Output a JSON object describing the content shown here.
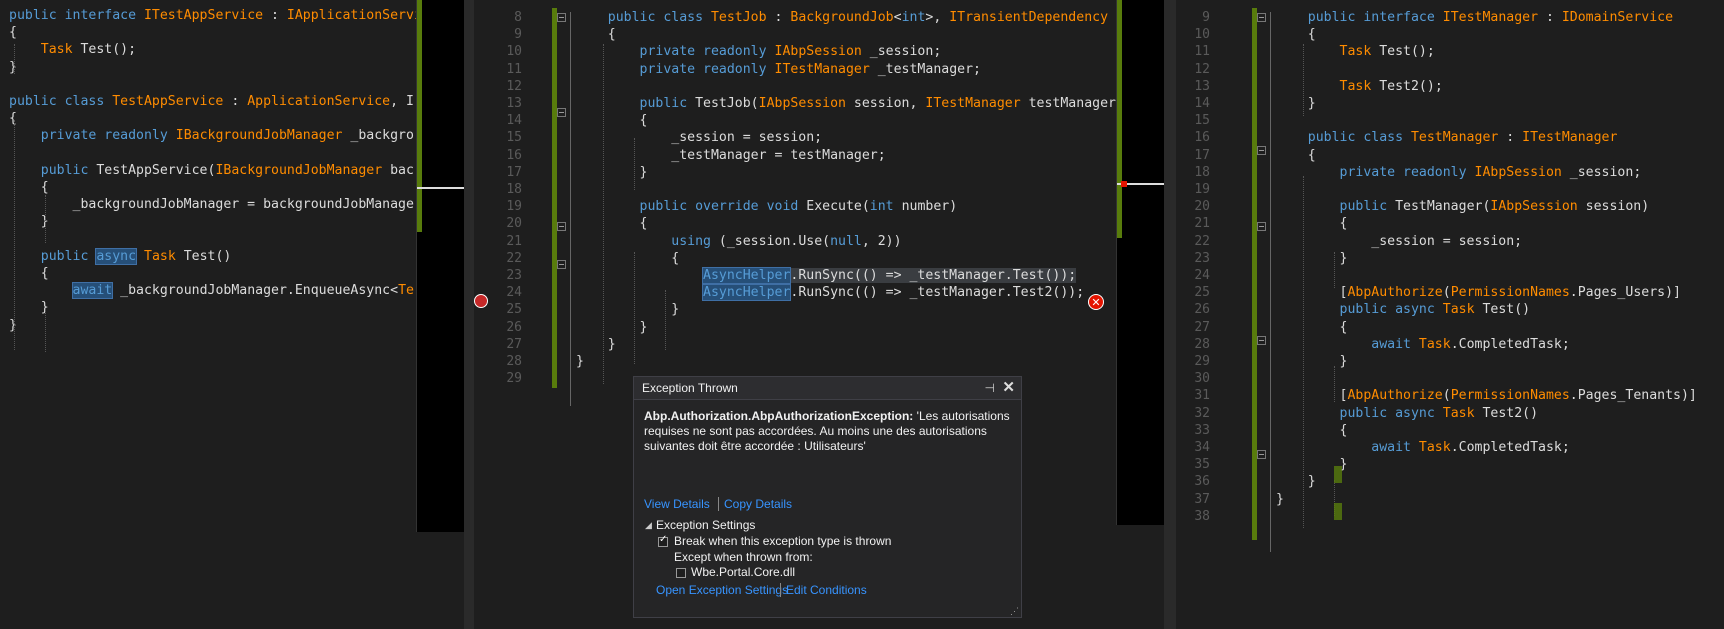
{
  "left": {
    "lines": [
      [
        [
          "kw",
          "public interface "
        ],
        [
          "ty",
          "ITestAppService"
        ],
        [
          "tx",
          " : "
        ],
        [
          "ty",
          "IApplicationServi"
        ]
      ],
      [
        [
          "tx",
          "{"
        ]
      ],
      [
        [
          "tx",
          "    "
        ],
        [
          "ty",
          "Task"
        ],
        [
          "tx",
          " Test();"
        ]
      ],
      [
        [
          "tx",
          "}"
        ]
      ],
      [
        [
          "tx",
          ""
        ]
      ],
      [
        [
          "kw",
          "public class "
        ],
        [
          "ty",
          "TestAppService"
        ],
        [
          "tx",
          " : "
        ],
        [
          "ty",
          "ApplicationService"
        ],
        [
          "tx",
          ", I"
        ]
      ],
      [
        [
          "tx",
          "{"
        ]
      ],
      [
        [
          "tx",
          "    "
        ],
        [
          "kw",
          "private readonly "
        ],
        [
          "ty",
          "IBackgroundJobManager"
        ],
        [
          "tx",
          " _backgro"
        ]
      ],
      [
        [
          "tx",
          ""
        ]
      ],
      [
        [
          "tx",
          "    "
        ],
        [
          "kw",
          "public "
        ],
        [
          "tx",
          "TestAppService("
        ],
        [
          "ty",
          "IBackgroundJobManager"
        ],
        [
          "tx",
          " bac"
        ]
      ],
      [
        [
          "tx",
          "    {"
        ]
      ],
      [
        [
          "tx",
          "        _backgroundJobManager = backgroundJobManage"
        ]
      ],
      [
        [
          "tx",
          "    }"
        ]
      ],
      [
        [
          "tx",
          ""
        ]
      ],
      [
        [
          "tx",
          "    "
        ],
        [
          "kw",
          "public "
        ],
        [
          "hlkw",
          "async"
        ],
        [
          "tx",
          " "
        ],
        [
          "ty",
          "Task"
        ],
        [
          "tx",
          " Test()"
        ]
      ],
      [
        [
          "tx",
          "    {"
        ]
      ],
      [
        [
          "tx",
          "        "
        ],
        [
          "hlkw",
          "await"
        ],
        [
          "tx",
          " _backgroundJobManager.EnqueueAsync<"
        ],
        [
          "ty",
          "Te"
        ]
      ],
      [
        [
          "tx",
          "    }"
        ]
      ],
      [
        [
          "tx",
          "}"
        ]
      ]
    ]
  },
  "middle": {
    "line_numbers": [
      "8",
      "9",
      "10",
      "11",
      "12",
      "13",
      "14",
      "15",
      "16",
      "17",
      "18",
      "19",
      "20",
      "21",
      "22",
      "23",
      "24",
      "25",
      "26",
      "27",
      "28",
      "29"
    ],
    "lines": [
      [
        [
          "tx",
          "    "
        ],
        [
          "kw",
          "public class "
        ],
        [
          "ty",
          "TestJob"
        ],
        [
          "tx",
          " : "
        ],
        [
          "ty",
          "BackgroundJob"
        ],
        [
          "tx",
          "<"
        ],
        [
          "kw",
          "int"
        ],
        [
          "tx",
          ">, "
        ],
        [
          "ty",
          "ITransientDependency"
        ]
      ],
      [
        [
          "tx",
          "    {"
        ]
      ],
      [
        [
          "tx",
          "        "
        ],
        [
          "kw",
          "private readonly "
        ],
        [
          "ty",
          "IAbpSession"
        ],
        [
          "tx",
          " _session;"
        ]
      ],
      [
        [
          "tx",
          "        "
        ],
        [
          "kw",
          "private readonly "
        ],
        [
          "ty",
          "ITestManager"
        ],
        [
          "tx",
          " _testManager;"
        ]
      ],
      [
        [
          "tx",
          ""
        ]
      ],
      [
        [
          "tx",
          "        "
        ],
        [
          "kw",
          "public "
        ],
        [
          "tx",
          "TestJob("
        ],
        [
          "ty",
          "IAbpSession"
        ],
        [
          "tx",
          " session, "
        ],
        [
          "ty",
          "ITestManager"
        ],
        [
          "tx",
          " testManager)"
        ]
      ],
      [
        [
          "tx",
          "        {"
        ]
      ],
      [
        [
          "tx",
          "            _session = session;"
        ]
      ],
      [
        [
          "tx",
          "            _testManager = testManager;"
        ]
      ],
      [
        [
          "tx",
          "        }"
        ]
      ],
      [
        [
          "tx",
          ""
        ]
      ],
      [
        [
          "tx",
          "        "
        ],
        [
          "kw",
          "public override void "
        ],
        [
          "tx",
          "Execute("
        ],
        [
          "kw",
          "int"
        ],
        [
          "tx",
          " number)"
        ]
      ],
      [
        [
          "tx",
          "        {"
        ]
      ],
      [
        [
          "tx",
          "            "
        ],
        [
          "kw",
          "using "
        ],
        [
          "tx",
          "(_session.Use("
        ],
        [
          "kw",
          "null"
        ],
        [
          "tx",
          ", 2))"
        ]
      ],
      [
        [
          "tx",
          "            {"
        ]
      ],
      [
        [
          "tx",
          "                "
        ],
        [
          "hlty",
          "AsyncHelper"
        ],
        [
          "hlsel",
          ".RunSync(() => _testManager.Test());"
        ]
      ],
      [
        [
          "tx",
          "                "
        ],
        [
          "hlty",
          "AsyncHelper"
        ],
        [
          "tx",
          ".RunSync(() => _testManager.Test2());"
        ]
      ],
      [
        [
          "tx",
          "            }"
        ]
      ],
      [
        [
          "tx",
          "        }"
        ]
      ],
      [
        [
          "tx",
          "    }"
        ]
      ],
      [
        [
          "tx",
          "}"
        ]
      ],
      [
        [
          "tx",
          ""
        ]
      ]
    ]
  },
  "right": {
    "line_numbers": [
      "9",
      "10",
      "11",
      "12",
      "13",
      "14",
      "15",
      "16",
      "17",
      "18",
      "19",
      "20",
      "21",
      "22",
      "23",
      "24",
      "25",
      "26",
      "27",
      "28",
      "29",
      "30",
      "31",
      "32",
      "33",
      "34",
      "35",
      "36",
      "37",
      "38"
    ],
    "lines": [
      [
        [
          "tx",
          "    "
        ],
        [
          "kw",
          "public interface "
        ],
        [
          "ty",
          "ITestManager"
        ],
        [
          "tx",
          " : "
        ],
        [
          "ty",
          "IDomainService"
        ]
      ],
      [
        [
          "tx",
          "    {"
        ]
      ],
      [
        [
          "tx",
          "        "
        ],
        [
          "ty",
          "Task"
        ],
        [
          "tx",
          " Test();"
        ]
      ],
      [
        [
          "tx",
          ""
        ]
      ],
      [
        [
          "tx",
          "        "
        ],
        [
          "ty",
          "Task"
        ],
        [
          "tx",
          " Test2();"
        ]
      ],
      [
        [
          "tx",
          "    }"
        ]
      ],
      [
        [
          "tx",
          ""
        ]
      ],
      [
        [
          "tx",
          "    "
        ],
        [
          "kw",
          "public class "
        ],
        [
          "ty",
          "TestManager"
        ],
        [
          "tx",
          " : "
        ],
        [
          "ty",
          "ITestManager"
        ]
      ],
      [
        [
          "tx",
          "    {"
        ]
      ],
      [
        [
          "tx",
          "        "
        ],
        [
          "kw",
          "private readonly "
        ],
        [
          "ty",
          "IAbpSession"
        ],
        [
          "tx",
          " _session;"
        ]
      ],
      [
        [
          "tx",
          ""
        ]
      ],
      [
        [
          "tx",
          "        "
        ],
        [
          "kw",
          "public "
        ],
        [
          "tx",
          "TestManager("
        ],
        [
          "ty",
          "IAbpSession"
        ],
        [
          "tx",
          " session)"
        ]
      ],
      [
        [
          "tx",
          "        {"
        ]
      ],
      [
        [
          "tx",
          "            _session = session;"
        ]
      ],
      [
        [
          "tx",
          "        }"
        ]
      ],
      [
        [
          "tx",
          ""
        ]
      ],
      [
        [
          "tx",
          "        ["
        ],
        [
          "ty",
          "AbpAuthorize"
        ],
        [
          "tx",
          "("
        ],
        [
          "ty",
          "PermissionNames"
        ],
        [
          "tx",
          ".Pages_Users)]"
        ]
      ],
      [
        [
          "tx",
          "        "
        ],
        [
          "kw",
          "public async "
        ],
        [
          "ty",
          "Task"
        ],
        [
          "tx",
          " Test()"
        ]
      ],
      [
        [
          "tx",
          "        {"
        ]
      ],
      [
        [
          "tx",
          "            "
        ],
        [
          "kw",
          "await "
        ],
        [
          "ty",
          "Task"
        ],
        [
          "tx",
          ".CompletedTask;"
        ]
      ],
      [
        [
          "tx",
          "        }"
        ]
      ],
      [
        [
          "tx",
          ""
        ]
      ],
      [
        [
          "tx",
          "        ["
        ],
        [
          "ty",
          "AbpAuthorize"
        ],
        [
          "tx",
          "("
        ],
        [
          "ty",
          "PermissionNames"
        ],
        [
          "tx",
          ".Pages_Tenants)]"
        ]
      ],
      [
        [
          "tx",
          "        "
        ],
        [
          "kw",
          "public async "
        ],
        [
          "ty",
          "Task"
        ],
        [
          "tx",
          " Test2()"
        ]
      ],
      [
        [
          "tx",
          "        {"
        ]
      ],
      [
        [
          "tx",
          "            "
        ],
        [
          "kw",
          "await "
        ],
        [
          "ty",
          "Task"
        ],
        [
          "tx",
          ".CompletedTask;"
        ]
      ],
      [
        [
          "tx",
          "        }"
        ]
      ],
      [
        [
          "tx",
          "    }"
        ]
      ],
      [
        [
          "tx",
          "}"
        ]
      ],
      [
        [
          "tx",
          ""
        ]
      ]
    ]
  },
  "popup": {
    "title": "Exception Thrown",
    "exception_type": "Abp.Authorization.AbpAuthorizationException:",
    "message_line1": " 'Les autorisations",
    "message_line2": "requises ne sont pas accordées. Au moins une des autorisations",
    "message_line3": "suivantes doit être accordée : Utilisateurs'",
    "view_details": "View Details",
    "copy_details": "Copy Details",
    "settings_header": "Exception Settings",
    "break_label": "Break when this exception type is thrown",
    "except_label": "Except when thrown from:",
    "dll_label": "Wbe.Portal.Core.dll",
    "open_settings": "Open Exception Settings",
    "edit_conditions": "Edit Conditions"
  },
  "colors": {
    "keyword": "#569cd6",
    "type": "#ff8c00",
    "text": "#dcdcdc",
    "change_bar": "#587c0c",
    "link": "#3794ff"
  }
}
